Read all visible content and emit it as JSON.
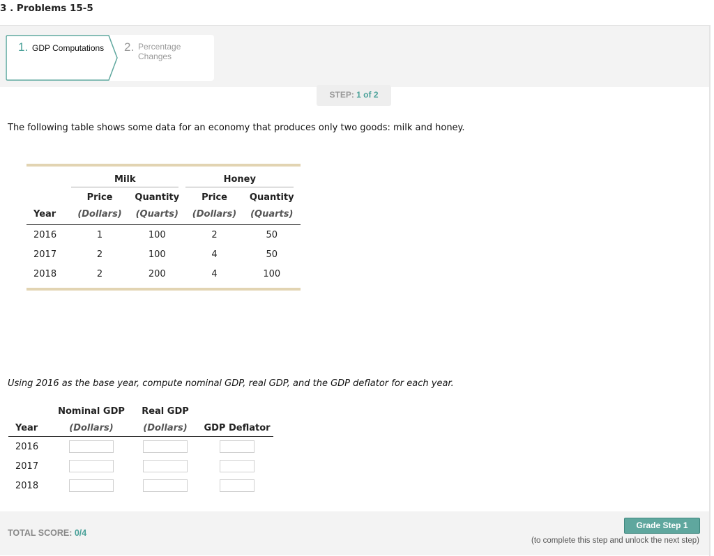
{
  "page": {
    "title": "3 . Problems 15-5"
  },
  "tabs": [
    {
      "num": "1.",
      "label": "GDP Computations",
      "active": true
    },
    {
      "num": "2.",
      "label": "Percentage Changes",
      "active": false
    }
  ],
  "step": {
    "prefix": "STEP: ",
    "current": "1 of 2"
  },
  "intro": "The following table shows some data for an economy that produces only two goods: milk and honey.",
  "data_table": {
    "groups": [
      "Milk",
      "Honey"
    ],
    "col_headers": [
      "Price",
      "Quantity",
      "Price",
      "Quantity"
    ],
    "year_header": "Year",
    "units": [
      "(Dollars)",
      "(Quarts)",
      "(Dollars)",
      "(Quarts)"
    ],
    "rows": [
      [
        "2016",
        "1",
        "100",
        "2",
        "50"
      ],
      [
        "2017",
        "2",
        "100",
        "4",
        "50"
      ],
      [
        "2018",
        "2",
        "200",
        "4",
        "100"
      ]
    ]
  },
  "question": "Using 2016 as the base year, compute nominal GDP, real GDP, and the GDP deflator for each year.",
  "answer_table": {
    "headers": [
      "Year",
      "Nominal GDP",
      "Real GDP",
      "GDP Deflator"
    ],
    "units": [
      "(Dollars)",
      "(Dollars)"
    ],
    "years": [
      "2016",
      "2017",
      "2018"
    ],
    "values": [
      [
        "",
        "",
        ""
      ],
      [
        "",
        "",
        ""
      ],
      [
        "",
        "",
        ""
      ]
    ]
  },
  "footer": {
    "total_label": "TOTAL SCORE: ",
    "total_value": "0/4",
    "grade_button": "Grade Step 1",
    "hint": "(to complete this step and unlock the next step)"
  },
  "colors": {
    "accent": "#4aa199",
    "header_bar": "#e2d4b2",
    "button": "#5fa79e",
    "panel_bg": "#f3f3f3"
  }
}
